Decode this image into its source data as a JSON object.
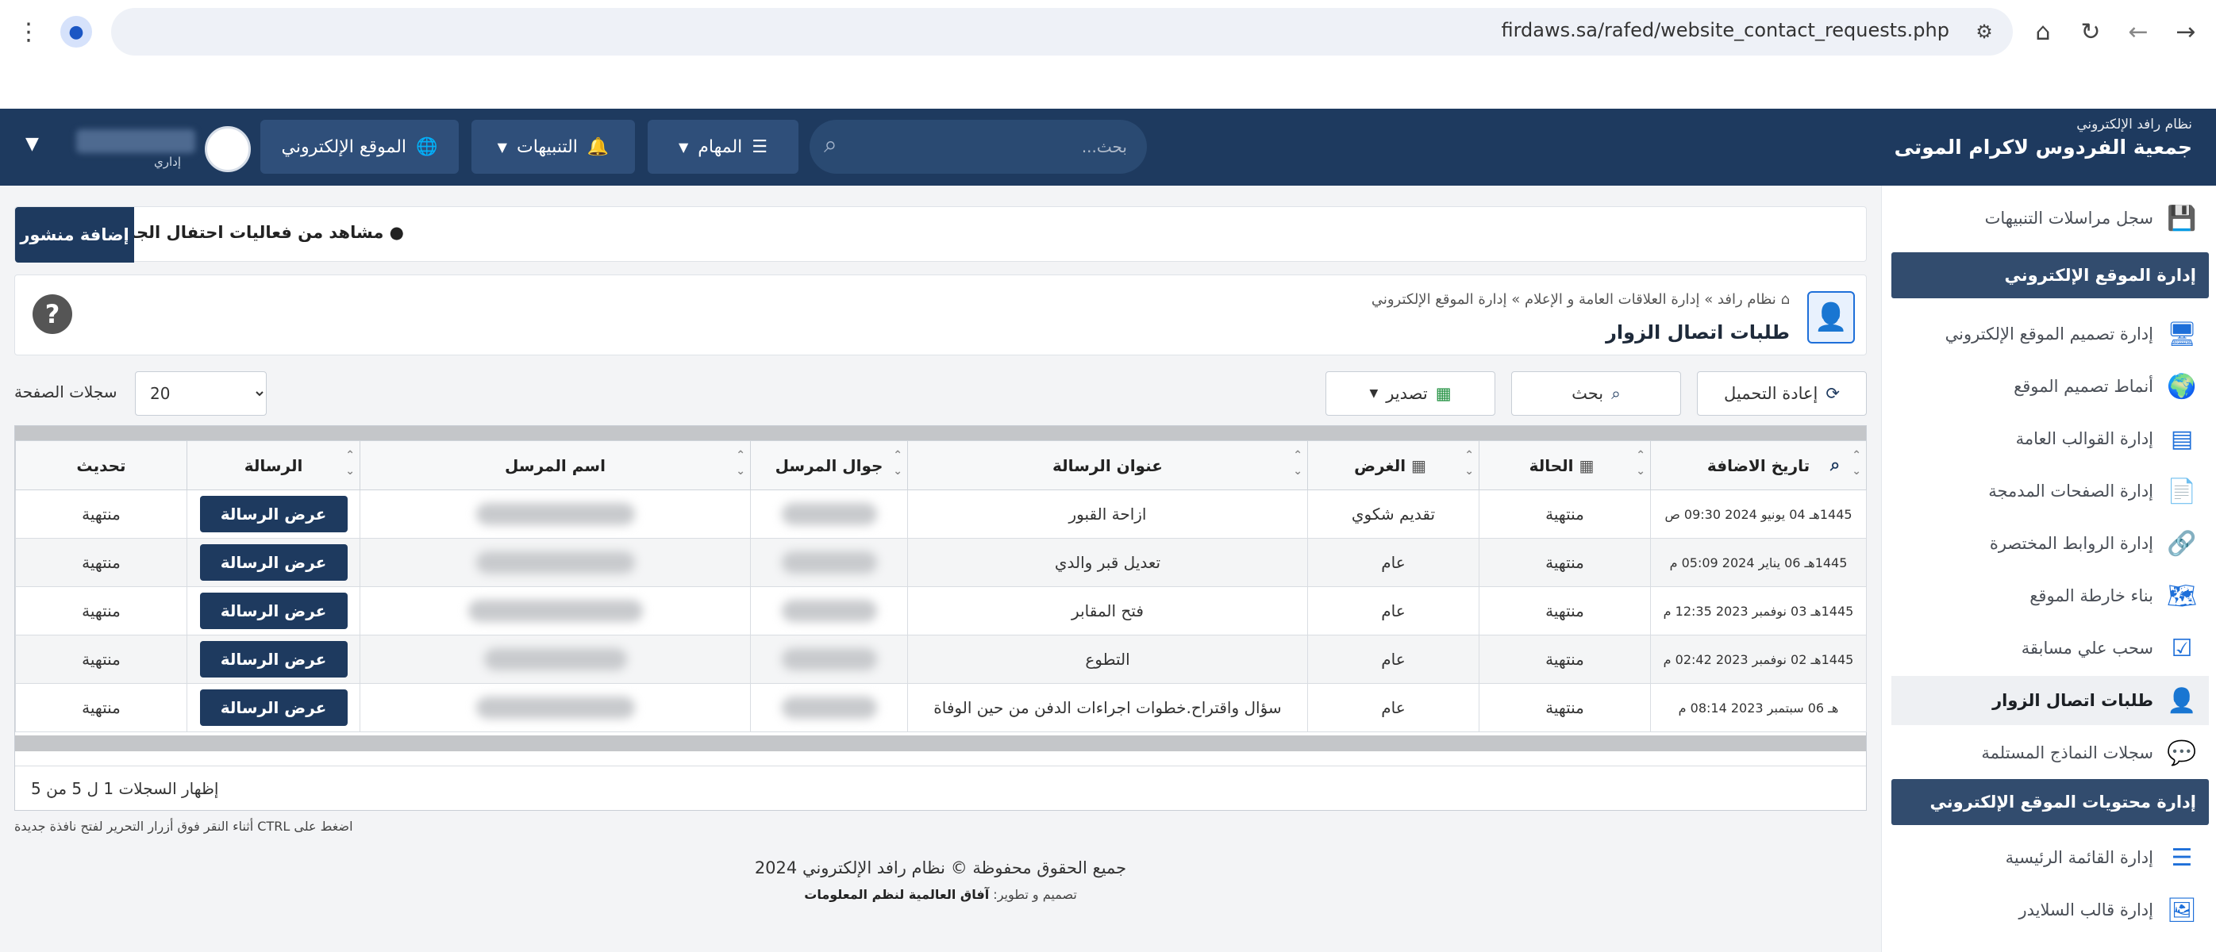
{
  "browser": {
    "url": "firdaws.sa/rafed/website_contact_requests.php"
  },
  "header": {
    "brand_sub": "نظام رافد الإلكتروني",
    "brand_name": "جمعية الفردوس لاكرام الموتى",
    "search_placeholder": "بحث...",
    "tasks_label": "المهام",
    "alerts_label": "التنبيهات",
    "website_label": "الموقع الإلكتروني",
    "user_role": "إداري"
  },
  "sidebar": {
    "items_top": [
      {
        "label": "سجل مراسلات التنبيهات",
        "icon": "save-icon"
      }
    ],
    "section1": "إدارة الموقع الإلكتروني",
    "items": [
      {
        "label": "إدارة تصميم الموقع الإلكتروني",
        "icon": "monitor-icon"
      },
      {
        "label": "أنماط تصميم الموقع",
        "icon": "globe-icon"
      },
      {
        "label": "إدارة القوالب العامة",
        "icon": "template-icon"
      },
      {
        "label": "إدارة الصفحات المدمجة",
        "icon": "pages-icon"
      },
      {
        "label": "إدارة الروابط المختصرة",
        "icon": "link-icon"
      },
      {
        "label": "بناء خارطة الموقع",
        "icon": "sitemap-icon"
      },
      {
        "label": "سحب علي مسابقة",
        "icon": "draw-icon"
      },
      {
        "label": "طلبات اتصال الزوار",
        "icon": "contact-icon",
        "active": true
      },
      {
        "label": "سجلات النماذج المستلمة",
        "icon": "forms-icon"
      }
    ],
    "section2": "إدارة محتويات الموقع الإلكتروني",
    "items2": [
      {
        "label": "إدارة القائمة الرئيسية",
        "icon": "menu-list-icon"
      },
      {
        "label": "إدارة قالب السلايدر",
        "icon": "slider-icon"
      }
    ]
  },
  "ticker": {
    "button": "إضافة منشور",
    "text": "مشاهد من فعاليات احتفال الجمعية"
  },
  "page": {
    "breadcrumb": "نظام رافد » إدارة العلاقات العامة و الإعلام » إدارة الموقع الإلكتروني",
    "title": "طلبات اتصال الزوار"
  },
  "toolbar": {
    "reload": "إعادة التحميل",
    "search": "بحث",
    "export": "تصدير",
    "per_page_label": "سجلات الصفحة",
    "per_page_value": "20"
  },
  "table": {
    "headers": {
      "date": "تاريخ الاضافة",
      "status": "الحالة",
      "purpose": "الغرض",
      "subject": "عنوان الرسالة",
      "mobile": "جوال المرسل",
      "sender": "اسم المرسل",
      "message": "الرسالة",
      "update": "تحديث"
    },
    "view_label": "عرض الرسالة",
    "rows": [
      {
        "date": "1445هـ 04 يونيو 2024 09:30 ص",
        "status": "منتهية",
        "purpose": "تقديم شكوي",
        "subject": "ازاحة القبور",
        "update": "منتهية"
      },
      {
        "date": "1445هـ 06 يناير 2024 05:09 م",
        "status": "منتهية",
        "purpose": "عام",
        "subject": "تعديل قبر والدي",
        "update": "منتهية"
      },
      {
        "date": "1445هـ 03 نوفمبر 2023 12:35 م",
        "status": "منتهية",
        "purpose": "عام",
        "subject": "فتح المقابر",
        "update": "منتهية"
      },
      {
        "date": "1445هـ 02 نوفمبر 2023 02:42 م",
        "status": "منتهية",
        "purpose": "عام",
        "subject": "التطوع",
        "update": "منتهية"
      },
      {
        "date": "هـ 06 سبتمبر 2023 08:14 م",
        "status": "منتهية",
        "purpose": "عام",
        "subject": "سؤال واقتراح.خطوات اجراءات الدفن من حين الوفاة",
        "update": "منتهية"
      }
    ],
    "footer": "إظهار السجلات 1 ل 5 من 5"
  },
  "footer": {
    "hint": "اضغط على CTRL أثناء النقر فوق أزرار التحرير لفتح نافذة جديدة",
    "copyright": "جميع الحقوق محفوظة © نظام رافد الإلكتروني 2024",
    "designer_prefix": "تصميم و تطوير:",
    "designer_name": "آفاق العالمية لنظم المعلومات"
  },
  "colors": {
    "navy": "#1e3a5f",
    "header": "#1e3a5f",
    "section": "#324c6e"
  }
}
